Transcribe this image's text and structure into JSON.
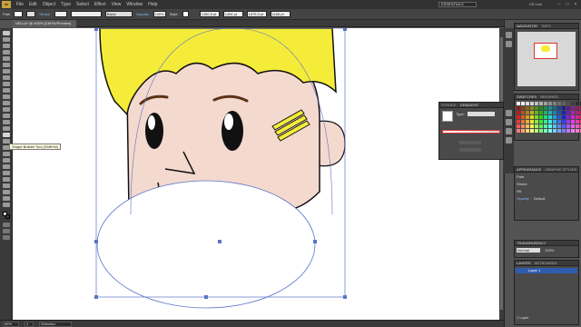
{
  "app": {
    "logo": "Ai",
    "workspace_label": "ESSENTIALS",
    "cs_live": "CS Live"
  },
  "menu": [
    "File",
    "Edit",
    "Object",
    "Type",
    "Select",
    "Effect",
    "View",
    "Window",
    "Help"
  ],
  "control_bar": {
    "selection_label": "Path",
    "stroke_label": "Stroke:",
    "brush_label": "Basic",
    "opacity_label": "Opacity:",
    "opacity_value": "100%",
    "style_label": "Style:",
    "x_value": "1280.5 pt",
    "y_value": "1494 pt",
    "w_value": "1075.5 pt",
    "h_value": "1168 pt"
  },
  "document_tab": {
    "title": "VELLA* @ 400% (CMYK/Preview)"
  },
  "tooltip": {
    "text": "Shape Builder Tool (Shift+M)"
  },
  "status_bar": {
    "zoom": "66%",
    "page": "1",
    "tool_name": "Selection"
  },
  "panels": {
    "navigator": {
      "tabs": [
        "NAVIGATOR",
        "INFO"
      ]
    },
    "swatches": {
      "tabs": [
        "SWATCHES",
        "BRUSHES",
        "SYMBOLS"
      ]
    },
    "stroke": {
      "tabs": [
        "STROKE",
        "GRADIENT",
        "TRANSPARENCY"
      ],
      "type_label": "Type:"
    },
    "appearance": {
      "tabs": [
        "APPEARANCE",
        "GRAPHIC STYLES"
      ],
      "item": "Path",
      "stroke_row": "Stroke:",
      "fill_row": "Fill:",
      "opacity_label": "Opacity:",
      "opacity_value": "Default"
    },
    "transparency": {
      "tabs": [
        "TRANSPARENCY"
      ],
      "mode": "Normal",
      "opacity": "100%"
    },
    "layers": {
      "tabs": [
        "LAYERS",
        "ARTBOARDS"
      ],
      "layer_name": "Layer 1",
      "footer": "1 Layer"
    }
  },
  "colors": {
    "hair": "#f5ec3a",
    "skin": "#f4d9cf",
    "selection": "#5a74c8",
    "accent": "#2f5bb0"
  }
}
